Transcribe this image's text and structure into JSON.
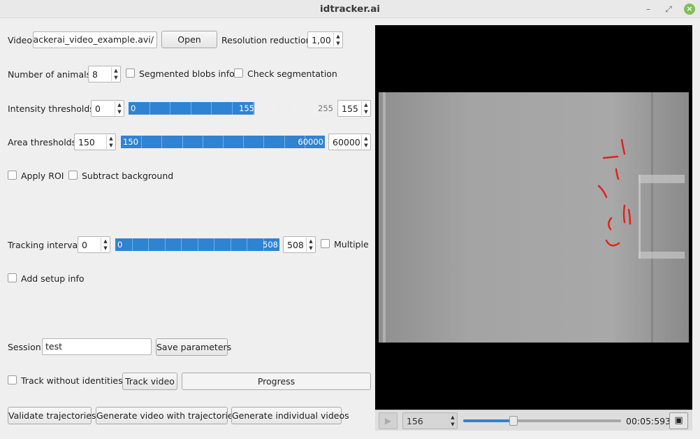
{
  "window": {
    "title": "idtracker.ai"
  },
  "video": {
    "label": "Video",
    "path": "/idtrackerai_video_example.avi",
    "open_button": "Open"
  },
  "resolution": {
    "label": "Resolution reduction",
    "value": "1,00"
  },
  "animals": {
    "label": "Number of animals",
    "value": "8",
    "segmented_label": "Segmented blobs info",
    "check_label": "Check segmentation"
  },
  "intensity": {
    "label": "Intensity thresholds",
    "min_value": "0",
    "slider_low": "0",
    "slider_high": "155",
    "slider_max": "255",
    "max_value": "155",
    "fill_fraction": 0.608
  },
  "area": {
    "label": "Area thresholds",
    "min_value": "150",
    "slider_low": "150",
    "slider_high": "60000",
    "max_value": "60000",
    "fill_fraction": 1.0
  },
  "roi": {
    "apply_label": "Apply ROI",
    "subtract_label": "Subtract background"
  },
  "tracking": {
    "label": "Tracking interval",
    "start_value": "0",
    "slider_low": "0",
    "slider_high": "508",
    "end_value": "508",
    "multiple_label": "Multiple",
    "fill_fraction": 1.0
  },
  "setup": {
    "label": "Add setup info"
  },
  "session": {
    "label": "Session",
    "value": "test",
    "save_button": "Save parameters"
  },
  "track": {
    "without_ids_label": "Track without identities",
    "track_button": "Track video",
    "progress_label": "Progress"
  },
  "bottom_buttons": {
    "validate": "Validate trajectories",
    "gen_video": "Generate video with trajectories",
    "gen_individual": "Generate individual videos"
  },
  "player": {
    "frame_value": "156",
    "time": "00:05:593",
    "seek_fraction": 0.32
  },
  "colors": {
    "accent": "#2f83d3",
    "animal": "#e0231c"
  },
  "icons": {
    "play": "play-icon",
    "fullscreen": "fullscreen-icon",
    "minimize": "minimize-icon",
    "restore": "restore-icon",
    "close": "close-icon"
  }
}
